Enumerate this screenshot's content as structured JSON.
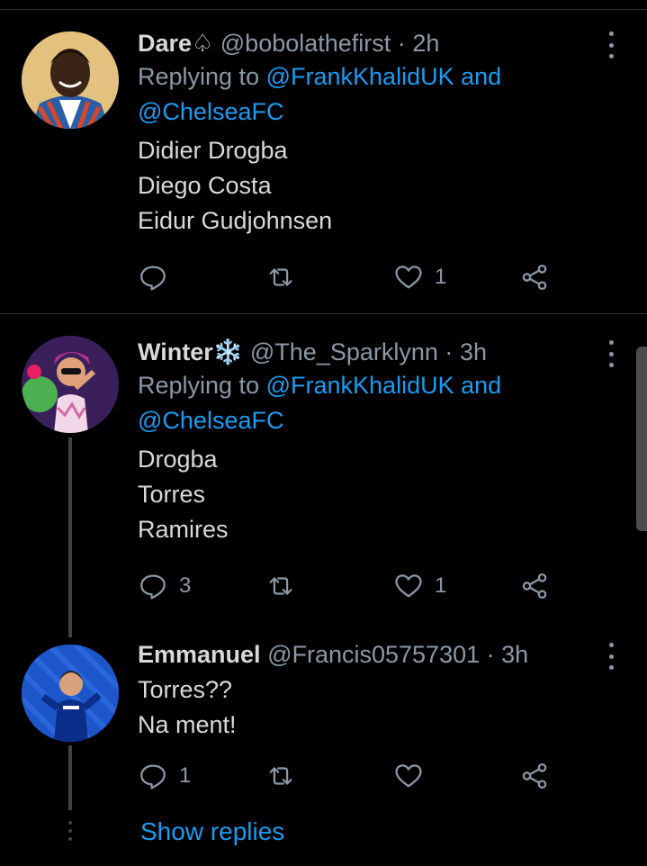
{
  "tweets": [
    {
      "name": "Dare♤",
      "handle": "@bobolathefirst",
      "separator": "·",
      "time": "2h",
      "replying_prefix": "Replying to",
      "mention1": "@FrankKhalidUK",
      "and_word": "and",
      "mention2": "@ChelseaFC",
      "lines": [
        "Didier Drogba",
        "Diego Costa",
        "Eidur Gudjohnsen"
      ],
      "reply_count": "",
      "retweet_count": "",
      "like_count": "1"
    },
    {
      "name": "Winter❄️",
      "handle": "@The_Sparklynn",
      "separator": "·",
      "time": "3h",
      "replying_prefix": "Replying to",
      "mention1": "@FrankKhalidUK",
      "and_word": "and",
      "mention2": "@ChelseaFC",
      "lines": [
        "Drogba",
        "Torres",
        "Ramires"
      ],
      "reply_count": "3",
      "retweet_count": "",
      "like_count": "1"
    },
    {
      "name": "Emmanuel",
      "handle": "@Francis05757301",
      "separator": "·",
      "time": "3h",
      "lines": [
        "Torres??",
        "Na ment!"
      ],
      "reply_count": "1",
      "retweet_count": "",
      "like_count": ""
    }
  ],
  "show_replies": "Show replies",
  "icons": {
    "more": "more-vertical-icon",
    "reply": "reply-icon",
    "retweet": "retweet-icon",
    "like": "like-icon",
    "share": "share-icon"
  },
  "colors": {
    "background": "#000000",
    "text": "#d9d9d9",
    "muted": "#8b98a5",
    "accent": "#1d9bf0"
  }
}
